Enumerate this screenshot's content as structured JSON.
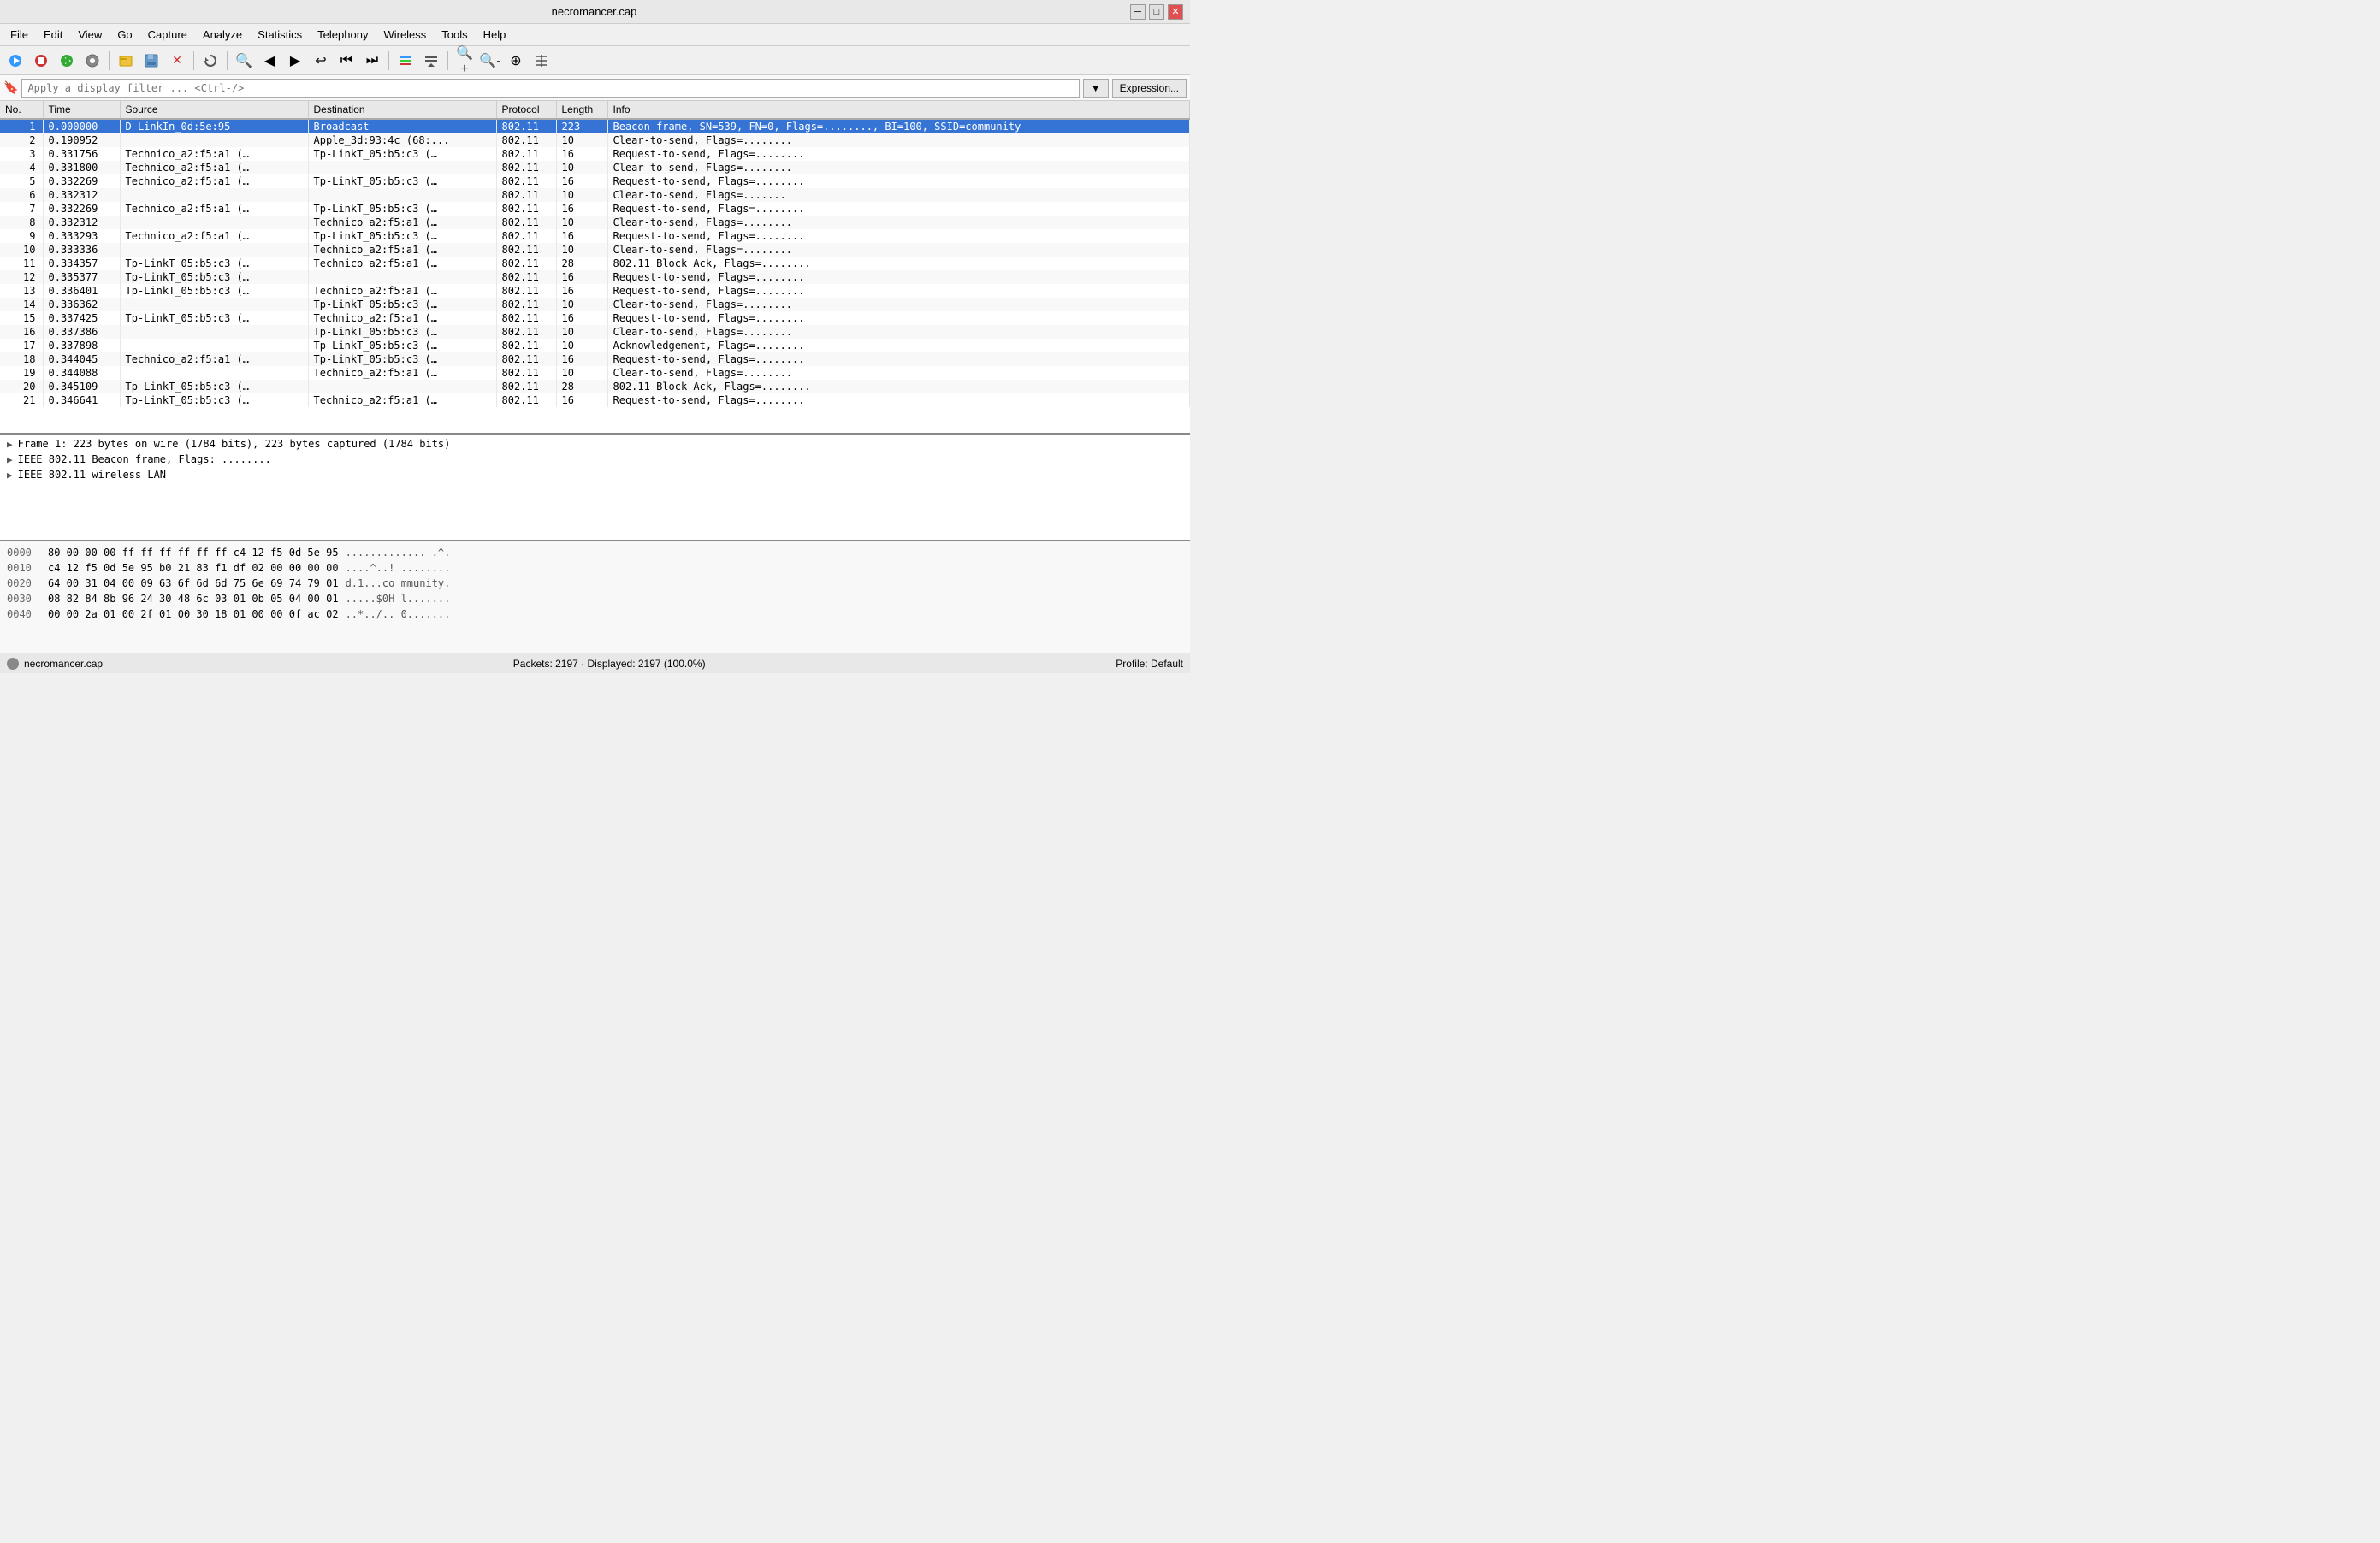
{
  "titleBar": {
    "title": "necromancer.cap",
    "minBtn": "─",
    "maxBtn": "□",
    "closeBtn": "✕"
  },
  "menuBar": {
    "items": [
      "File",
      "Edit",
      "View",
      "Go",
      "Capture",
      "Analyze",
      "Statistics",
      "Telephony",
      "Wireless",
      "Tools",
      "Help"
    ]
  },
  "toolbar": {
    "buttons": [
      "▶",
      "■",
      "↺",
      "⊙",
      "⎘",
      "📋",
      "✕",
      "↻",
      "🔍",
      "◀",
      "▶",
      "↩",
      "⏮",
      "⏭",
      "≡",
      "≣",
      "🔍",
      "🔎",
      "⊕",
      "⊟"
    ]
  },
  "filterBar": {
    "placeholder": "Apply a display filter ... <Ctrl-/>",
    "expressionBtn": "Expression...",
    "dropdownBtn": "▼"
  },
  "packetList": {
    "headers": [
      "No.",
      "Time",
      "Source",
      "Destination",
      "Protocol",
      "Length",
      "Info"
    ],
    "rows": [
      {
        "no": "1",
        "time": "0.000000",
        "src": "D-LinkIn_0d:5e:95",
        "dst": "Broadcast",
        "proto": "802.11",
        "len": "223",
        "info": "Beacon frame, SN=539, FN=0, Flags=........, BI=100, SSID=community",
        "selected": true
      },
      {
        "no": "2",
        "time": "0.190952",
        "src": "",
        "dst": "Apple_3d:93:4c (68:...",
        "proto": "802.11",
        "len": "10",
        "info": "Clear-to-send, Flags=........",
        "selected": false
      },
      {
        "no": "3",
        "time": "0.331756",
        "src": "Technico_a2:f5:a1 (…",
        "dst": "Tp-LinkT_05:b5:c3 (…",
        "proto": "802.11",
        "len": "16",
        "info": "Request-to-send, Flags=........",
        "selected": false
      },
      {
        "no": "4",
        "time": "0.331800",
        "src": "Technico_a2:f5:a1 (…",
        "dst": "",
        "proto": "802.11",
        "len": "10",
        "info": "Clear-to-send, Flags=........",
        "selected": false
      },
      {
        "no": "5",
        "time": "0.332269",
        "src": "Technico_a2:f5:a1 (…",
        "dst": "Tp-LinkT_05:b5:c3 (…",
        "proto": "802.11",
        "len": "16",
        "info": "Request-to-send, Flags=........",
        "selected": false
      },
      {
        "no": "6",
        "time": "0.332312",
        "src": "",
        "dst": "",
        "proto": "802.11",
        "len": "10",
        "info": "Clear-to-send, Flags=.......",
        "selected": false
      },
      {
        "no": "7",
        "time": "0.332269",
        "src": "Technico_a2:f5:a1 (…",
        "dst": "Tp-LinkT_05:b5:c3 (…",
        "proto": "802.11",
        "len": "16",
        "info": "Request-to-send, Flags=........",
        "selected": false
      },
      {
        "no": "8",
        "time": "0.332312",
        "src": "",
        "dst": "Technico_a2:f5:a1 (…",
        "proto": "802.11",
        "len": "10",
        "info": "Clear-to-send, Flags=........",
        "selected": false
      },
      {
        "no": "9",
        "time": "0.333293",
        "src": "Technico_a2:f5:a1 (…",
        "dst": "Tp-LinkT_05:b5:c3 (…",
        "proto": "802.11",
        "len": "16",
        "info": "Request-to-send, Flags=........",
        "selected": false
      },
      {
        "no": "10",
        "time": "0.333336",
        "src": "",
        "dst": "Technico_a2:f5:a1 (…",
        "proto": "802.11",
        "len": "10",
        "info": "Clear-to-send, Flags=........",
        "selected": false
      },
      {
        "no": "11",
        "time": "0.334357",
        "src": "Tp-LinkT_05:b5:c3 (…",
        "dst": "Technico_a2:f5:a1 (…",
        "proto": "802.11",
        "len": "28",
        "info": "802.11 Block Ack, Flags=........",
        "selected": false
      },
      {
        "no": "12",
        "time": "0.335377",
        "src": "Tp-LinkT_05:b5:c3 (…",
        "dst": "",
        "proto": "802.11",
        "len": "16",
        "info": "Request-to-send, Flags=........",
        "selected": false
      },
      {
        "no": "13",
        "time": "0.336401",
        "src": "Tp-LinkT_05:b5:c3 (…",
        "dst": "Technico_a2:f5:a1 (…",
        "proto": "802.11",
        "len": "16",
        "info": "Request-to-send, Flags=........",
        "selected": false
      },
      {
        "no": "14",
        "time": "0.336362",
        "src": "",
        "dst": "Tp-LinkT_05:b5:c3 (…",
        "proto": "802.11",
        "len": "10",
        "info": "Clear-to-send, Flags=........",
        "selected": false
      },
      {
        "no": "15",
        "time": "0.337425",
        "src": "Tp-LinkT_05:b5:c3 (…",
        "dst": "Technico_a2:f5:a1 (…",
        "proto": "802.11",
        "len": "16",
        "info": "Request-to-send, Flags=........",
        "selected": false
      },
      {
        "no": "16",
        "time": "0.337386",
        "src": "",
        "dst": "Tp-LinkT_05:b5:c3 (…",
        "proto": "802.11",
        "len": "10",
        "info": "Clear-to-send, Flags=........",
        "selected": false
      },
      {
        "no": "17",
        "time": "0.337898",
        "src": "",
        "dst": "Tp-LinkT_05:b5:c3 (…",
        "proto": "802.11",
        "len": "10",
        "info": "Acknowledgement, Flags=........",
        "selected": false
      },
      {
        "no": "18",
        "time": "0.344045",
        "src": "Technico_a2:f5:a1 (…",
        "dst": "Tp-LinkT_05:b5:c3 (…",
        "proto": "802.11",
        "len": "16",
        "info": "Request-to-send, Flags=........",
        "selected": false
      },
      {
        "no": "19",
        "time": "0.344088",
        "src": "",
        "dst": "Technico_a2:f5:a1 (…",
        "proto": "802.11",
        "len": "10",
        "info": "Clear-to-send, Flags=........",
        "selected": false
      },
      {
        "no": "20",
        "time": "0.345109",
        "src": "Tp-LinkT_05:b5:c3 (…",
        "dst": "",
        "proto": "802.11",
        "len": "28",
        "info": "802.11 Block Ack, Flags=........",
        "selected": false
      },
      {
        "no": "21",
        "time": "0.346641",
        "src": "Tp-LinkT_05:b5:c3 (…",
        "dst": "Technico_a2:f5:a1 (…",
        "proto": "802.11",
        "len": "16",
        "info": "Request-to-send, Flags=........",
        "selected": false
      }
    ]
  },
  "detailPanel": {
    "items": [
      {
        "text": "Frame 1: 223 bytes on wire (1784 bits), 223 bytes captured (1784 bits)",
        "expanded": false
      },
      {
        "text": "IEEE 802.11 Beacon frame, Flags: ........",
        "expanded": false
      },
      {
        "text": "IEEE 802.11 wireless LAN",
        "expanded": false
      }
    ]
  },
  "hexPanel": {
    "rows": [
      {
        "offset": "0000",
        "bytes": "80 00 00 00 ff ff ff ff  ff ff c4 12 f5 0d 5e 95",
        "ascii": "............. .^."
      },
      {
        "offset": "0010",
        "bytes": "c4 12 f5 0d 5e 95 b0 21  83 f1 df 02 00 00 00 00",
        "ascii": "....^..! ........"
      },
      {
        "offset": "0020",
        "bytes": "64 00 31 04 00 09 63 6f  6d 6d 75 6e 69 74 79 01",
        "ascii": "d.1...co mmunity."
      },
      {
        "offset": "0030",
        "bytes": "08 82 84 8b 96 24 30 48  6c 03 01 0b 05 04 00 01",
        "ascii": ".....$0H l......."
      },
      {
        "offset": "0040",
        "bytes": "00 00 2a 01 00 2f 01 00  30 18 01 00 00 0f ac 02",
        "ascii": "..*../.. 0......."
      }
    ]
  },
  "statusBar": {
    "filename": "necromancer.cap",
    "stats": "Packets: 2197 · Displayed: 2197 (100.0%)",
    "profile": "Profile: Default"
  },
  "colors": {
    "selectedRow": "#3574d4",
    "selectedBg": "#1a5fb4"
  }
}
